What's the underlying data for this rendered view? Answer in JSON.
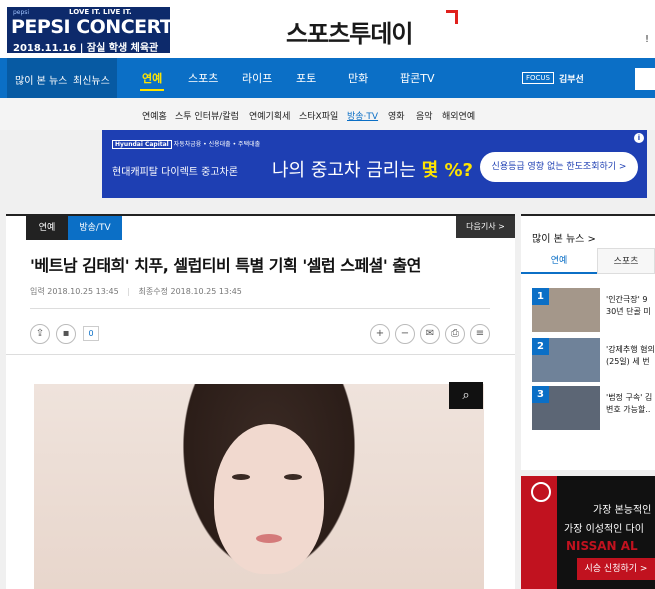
{
  "header": {
    "promo_small": "pepsi",
    "promo_tagline": "LOVE IT. LIVE IT.",
    "promo_title": "PEPSI CONCERT",
    "promo_date": "2018.11.16 | 잠실 학생 체육관",
    "logo_text": "스포츠투데이",
    "right_text": "!"
  },
  "nav": {
    "hot_news": "많이 본 뉴스",
    "latest_news": "최신뉴스",
    "items": [
      "연예",
      "스포츠",
      "라이프",
      "포토",
      "만화",
      "팝콘TV"
    ],
    "active": "연예",
    "focus_tag": "FOCUS",
    "focus_name": "김부선"
  },
  "subnav": {
    "items": [
      "연예홈",
      "스투 인터뷰/칼럼",
      "연예기획세",
      "스타X파일",
      "방송·TV",
      "영화",
      "음악",
      "해외연예"
    ],
    "active": "방송·TV"
  },
  "ad": {
    "brand": "Hyundai Capital",
    "brand_sub": "자동차금융 • 신용대출 • 주택대출",
    "line1": "현대캐피탈 다이렉트 중고차론",
    "line2_pre": "나의 중고차 금리는 ",
    "line2_highlight": "몇 %?",
    "cta": "신용등급 영향 없는 한도조회하기 >",
    "info": "i"
  },
  "article": {
    "category": "연예",
    "subcategory": "방송/TV",
    "next_label": "다음기사 >",
    "headline": "'베트남 김태희' 치푸, 셀럽티비 특별 기획 '셀럽 스페셜' 출연",
    "input_label": "입력",
    "input_date": "2018.10.25 13:45",
    "modified_label": "최종수정",
    "modified_date": "2018.10.25 13:45",
    "share_count": "0"
  },
  "sidebar": {
    "title": "많이 본 뉴스 >",
    "tabs": [
      "연예",
      "스포츠"
    ],
    "items": [
      {
        "rank": "1",
        "line1": "'인간극장' 9",
        "line2": "30년 단골 미"
      },
      {
        "rank": "2",
        "line1": "'강제추행 혐의",
        "line2": "(25일) 세 번"
      },
      {
        "rank": "3",
        "line1": "'법정 구속' 김",
        "line2": "변호 가능할.."
      }
    ]
  },
  "nissan_ad": {
    "t1": "가장 본능적인",
    "t2": "가장 이성적인 다이",
    "t3": "NISSAN AL",
    "cta": "시승 신청하기 >"
  },
  "colors": {
    "nav_blue": "#0b6fc6",
    "nav_dark": "#075aa3",
    "highlight_yellow": "#ffe400",
    "ad_blue": "#1e3fb3",
    "logo_red": "#e0201c"
  }
}
